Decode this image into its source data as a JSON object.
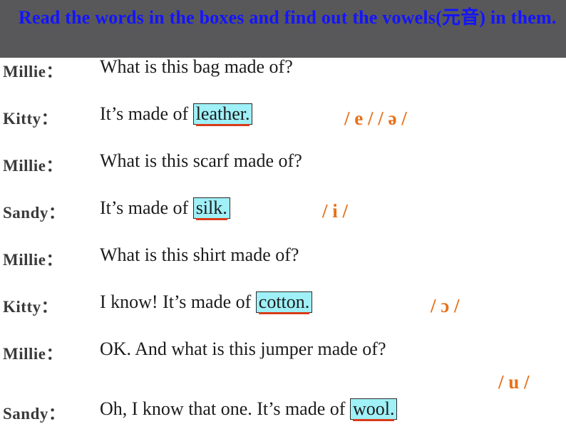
{
  "header": {
    "title": "Read the words in the boxes and find out the vowels(元音) in them."
  },
  "dialogue": [
    {
      "speaker": "Millie：",
      "pre": "What is this bag made of?",
      "box": null,
      "post": "",
      "phonetic": ""
    },
    {
      "speaker": "Kitty：",
      "pre": "It’s made of ",
      "box": "leather.",
      "post": "",
      "phonetic": "/ e / / ə /"
    },
    {
      "speaker": "Millie：",
      "pre": "What is this scarf made of?",
      "box": null,
      "post": "",
      "phonetic": ""
    },
    {
      "speaker": "Sandy：",
      "pre": "It’s made of ",
      "box": "silk.",
      "post": "",
      "phonetic": "/ i /"
    },
    {
      "speaker": "Millie：",
      "pre": "What is this shirt made of?",
      "box": null,
      "post": "",
      "phonetic": ""
    },
    {
      "speaker": "Kitty：",
      "pre": "I know! It’s made of ",
      "box": "cotton.",
      "post": "",
      "phonetic": "/ ɔ /"
    },
    {
      "speaker": "Millie：",
      "pre": "OK. And what is this jumper made of?",
      "box": null,
      "post": "",
      "phonetic": ""
    },
    {
      "speaker": "Sandy：",
      "pre": "Oh, I know that one. It’s made of ",
      "box": "wool.",
      "post": "",
      "phonetic": "/ u /"
    }
  ],
  "colors": {
    "header_bg": "#58585a",
    "title_text": "#1414ff",
    "box_fill": "#9ff0f7",
    "underline": "#d93b1a",
    "phonetic": "#e8711a"
  }
}
